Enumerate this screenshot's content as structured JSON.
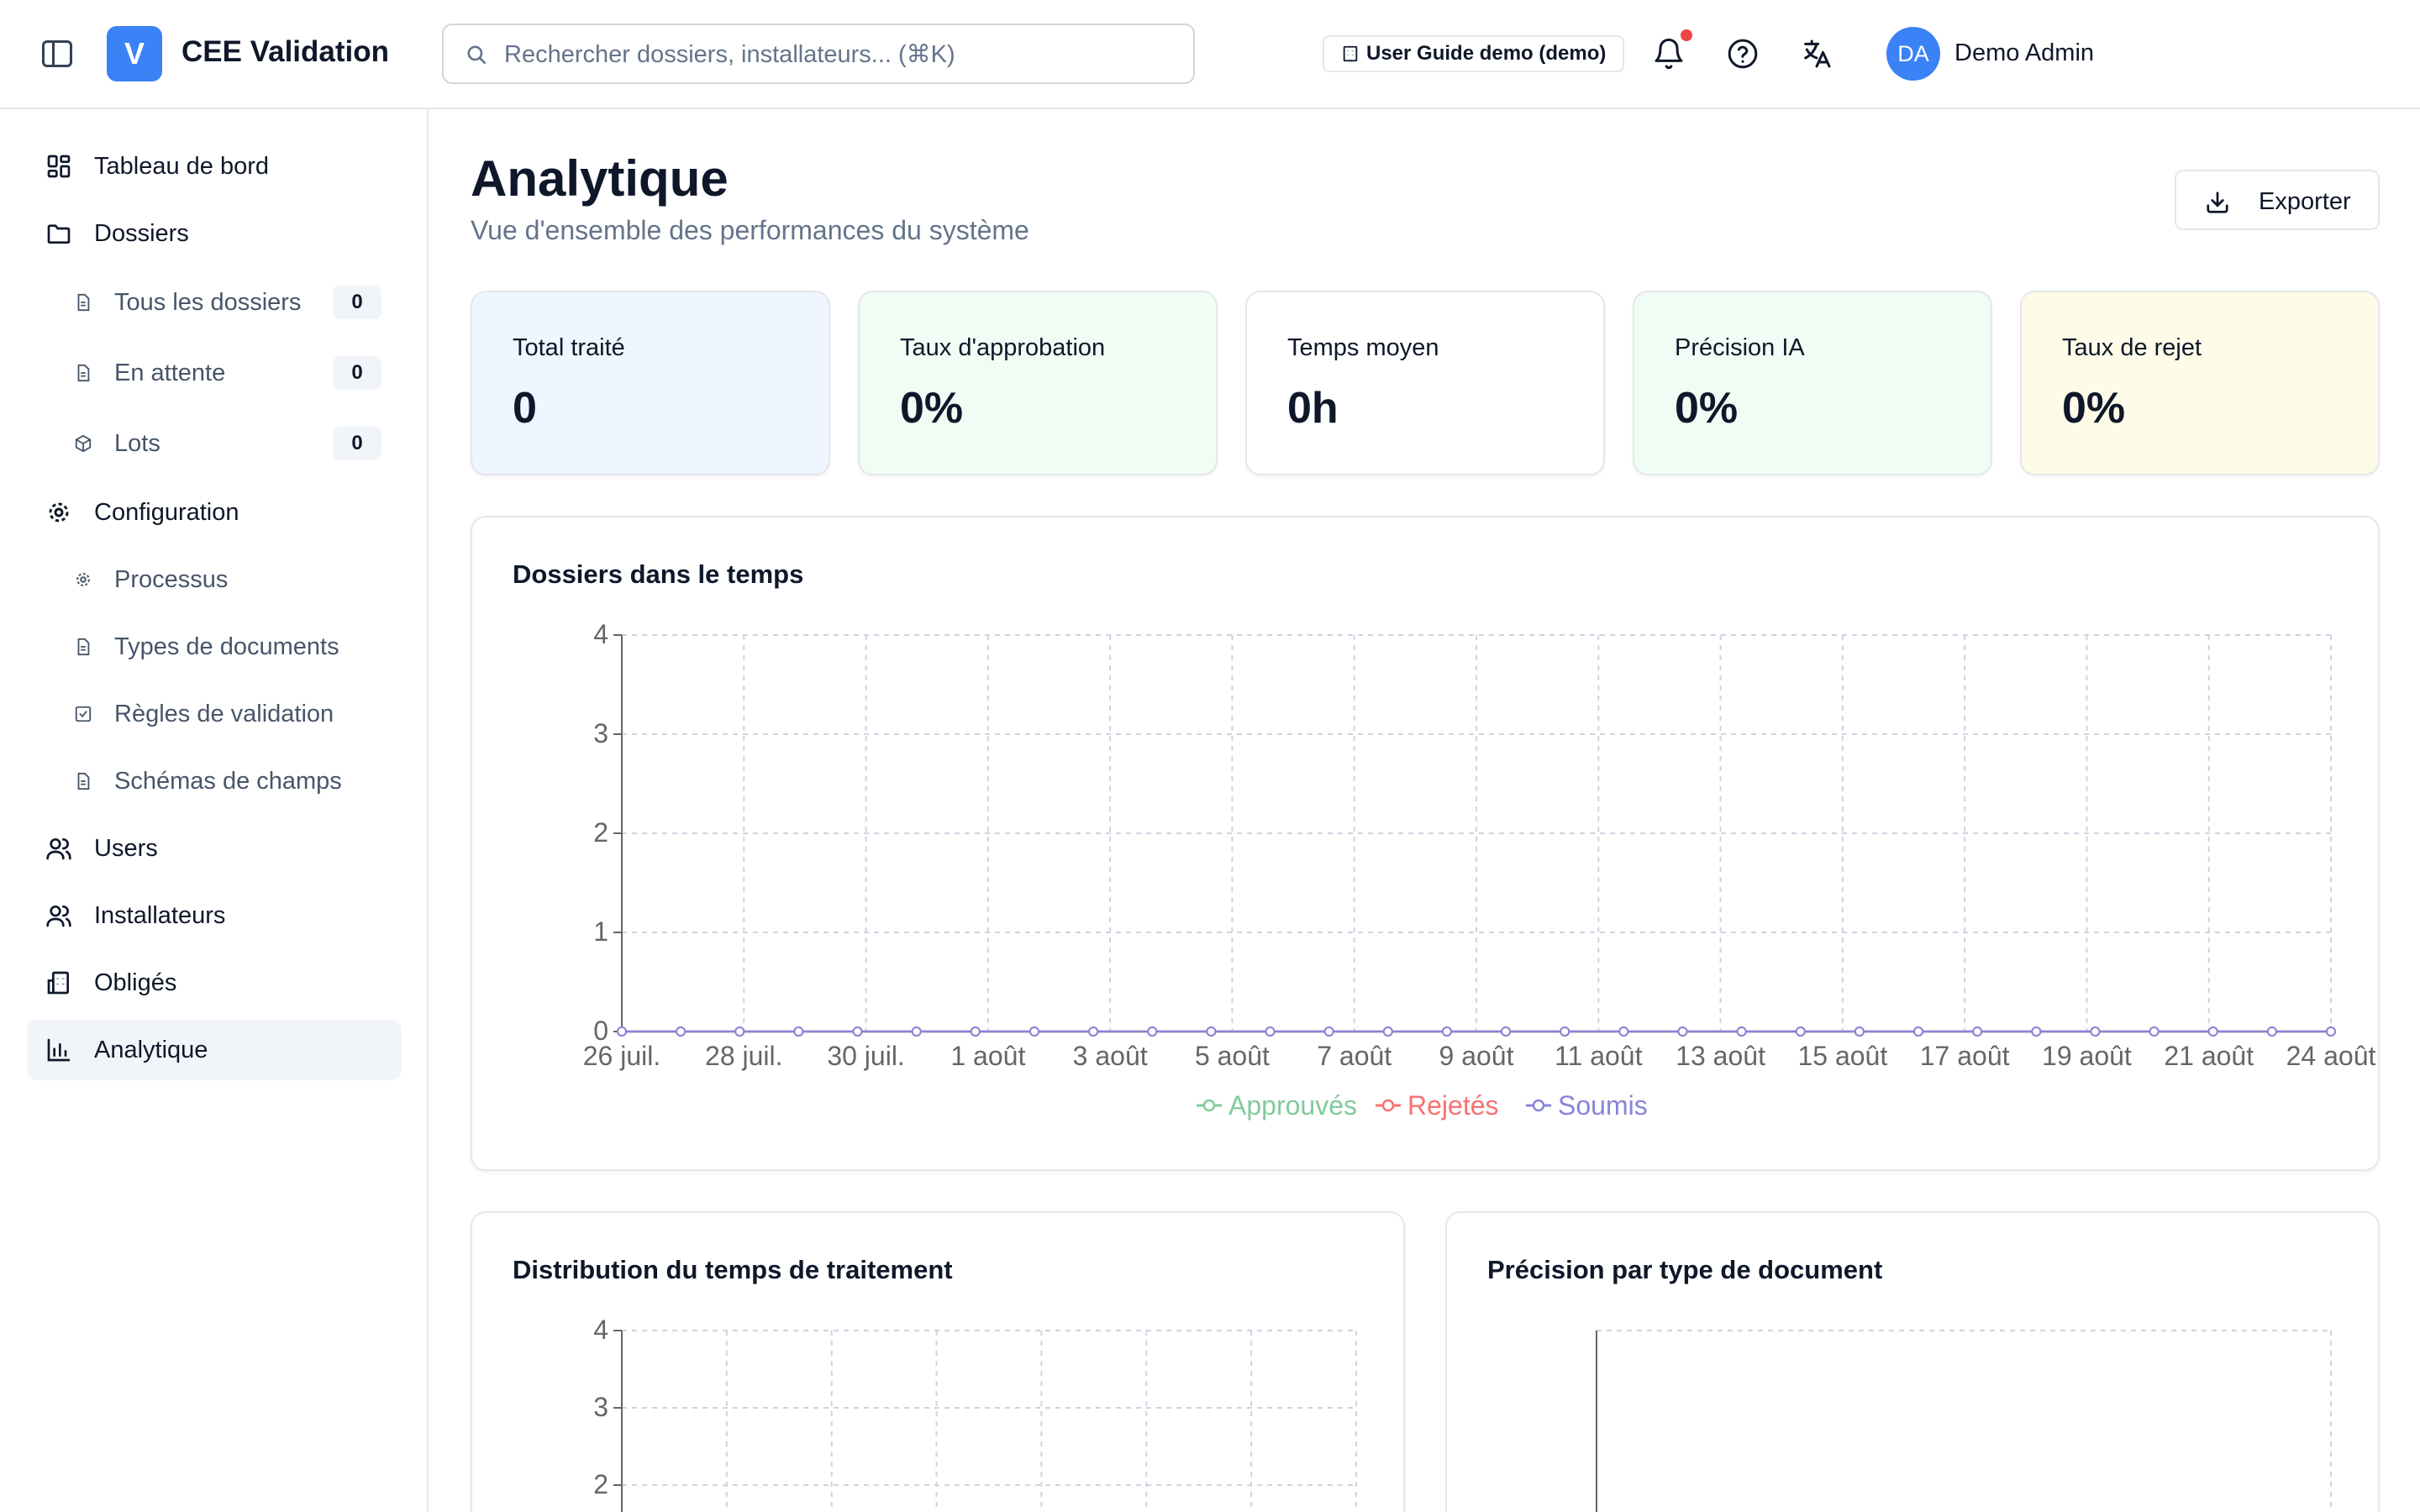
{
  "header": {
    "logo_letter": "V",
    "app_title": "CEE Validation",
    "search_placeholder": "Rechercher dossiers, installateurs... (⌘K)",
    "tenant_label": "User Guide demo (demo)",
    "user_initials": "DA",
    "user_name": "Demo Admin",
    "icons": [
      "sidebar-toggle-icon",
      "search-icon",
      "building-icon",
      "bell-icon",
      "help-icon",
      "translate-icon"
    ]
  },
  "sidebar": {
    "dashboard": "Tableau de bord",
    "dossiers": "Dossiers",
    "dossiers_items": [
      {
        "label": "Tous les dossiers",
        "count": "0"
      },
      {
        "label": "En attente",
        "count": "0"
      },
      {
        "label": "Lots",
        "count": "0"
      }
    ],
    "configuration": "Configuration",
    "configuration_items": [
      {
        "label": "Processus"
      },
      {
        "label": "Types de documents"
      },
      {
        "label": "Règles de validation"
      },
      {
        "label": "Schémas de champs"
      }
    ],
    "users": "Users",
    "installateurs": "Installateurs",
    "obliges": "Obligés",
    "analytique": "Analytique"
  },
  "main": {
    "title": "Analytique",
    "subtitle": "Vue d'ensemble des performances du système",
    "export_label": "Exporter",
    "stats": [
      {
        "label": "Total traité",
        "value": "0",
        "bg": "#eff6ff"
      },
      {
        "label": "Taux d'approbation",
        "value": "0%",
        "bg": "#f0fdf4"
      },
      {
        "label": "Temps moyen",
        "value": "0h",
        "bg": "#ffffff"
      },
      {
        "label": "Précision IA",
        "value": "0%",
        "bg": "#f0fdf4"
      },
      {
        "label": "Taux de rejet",
        "value": "0%",
        "bg": "#fefce8"
      }
    ],
    "timeline_title": "Dossiers dans le temps",
    "distribution_title": "Distribution du temps de traitement",
    "precision_title": "Précision par type de document"
  },
  "chart_data": [
    {
      "type": "line",
      "x_tick_labels": [
        "26 juil.",
        "28 juil.",
        "30 juil.",
        "1 août",
        "3 août",
        "5 août",
        "7 août",
        "9 août",
        "11 août",
        "13 août",
        "15 août",
        "17 août",
        "19 août",
        "21 août",
        "24 août"
      ],
      "x_points": 30,
      "y_ticks": [
        "0",
        "1",
        "2",
        "3",
        "4"
      ],
      "ylim": [
        0,
        4
      ],
      "grid": true,
      "legend_placement": "bottom",
      "series": [
        {
          "name": "Approuvés",
          "color": "#82ca9d",
          "values": [
            0,
            0,
            0,
            0,
            0,
            0,
            0,
            0,
            0,
            0,
            0,
            0,
            0,
            0,
            0,
            0,
            0,
            0,
            0,
            0,
            0,
            0,
            0,
            0,
            0,
            0,
            0,
            0,
            0,
            0
          ]
        },
        {
          "name": "Rejetés",
          "color": "#f87171",
          "values": [
            0,
            0,
            0,
            0,
            0,
            0,
            0,
            0,
            0,
            0,
            0,
            0,
            0,
            0,
            0,
            0,
            0,
            0,
            0,
            0,
            0,
            0,
            0,
            0,
            0,
            0,
            0,
            0,
            0,
            0
          ]
        },
        {
          "name": "Soumis",
          "color": "#8884d8",
          "values": [
            0,
            0,
            0,
            0,
            0,
            0,
            0,
            0,
            0,
            0,
            0,
            0,
            0,
            0,
            0,
            0,
            0,
            0,
            0,
            0,
            0,
            0,
            0,
            0,
            0,
            0,
            0,
            0,
            0,
            0
          ]
        }
      ]
    },
    {
      "type": "bar",
      "y_ticks": [
        "2",
        "3",
        "4"
      ],
      "ylim": [
        0,
        4
      ],
      "grid": true
    },
    {
      "type": "bar",
      "grid": true
    }
  ]
}
